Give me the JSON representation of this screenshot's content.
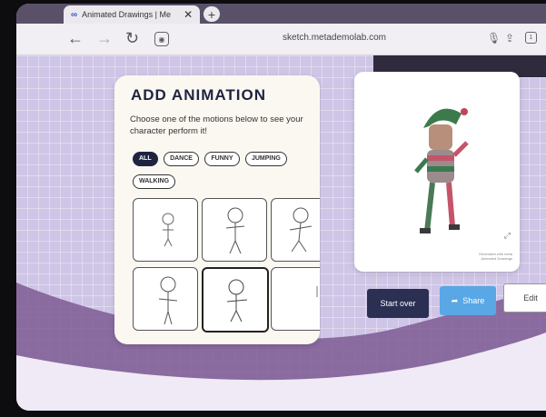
{
  "browser": {
    "tab_title": "Animated Drawings | Me",
    "tab_icon": "∞",
    "tab_close": "✕",
    "new_tab": "+",
    "url": "sketch.metademolab.com"
  },
  "card": {
    "heading": "ADD ANIMATION",
    "description": "Choose one of the motions below to see your character perform it!",
    "filters": [
      {
        "label": "ALL",
        "active": true
      },
      {
        "label": "DANCE",
        "active": false
      },
      {
        "label": "FUNNY",
        "active": false
      },
      {
        "label": "JUMPING",
        "active": false
      },
      {
        "label": "WALKING",
        "active": false
      }
    ]
  },
  "preview": {
    "credit": "Generated with meta Animated Drawings"
  },
  "actions": {
    "start_over": "Start over",
    "share": "Share",
    "edit": "Edit"
  },
  "colors": {
    "heading": "#1e2340",
    "start_button": "#2b2f52",
    "share_button": "#5aa7e6",
    "page_bg": "#cfc5e6"
  }
}
